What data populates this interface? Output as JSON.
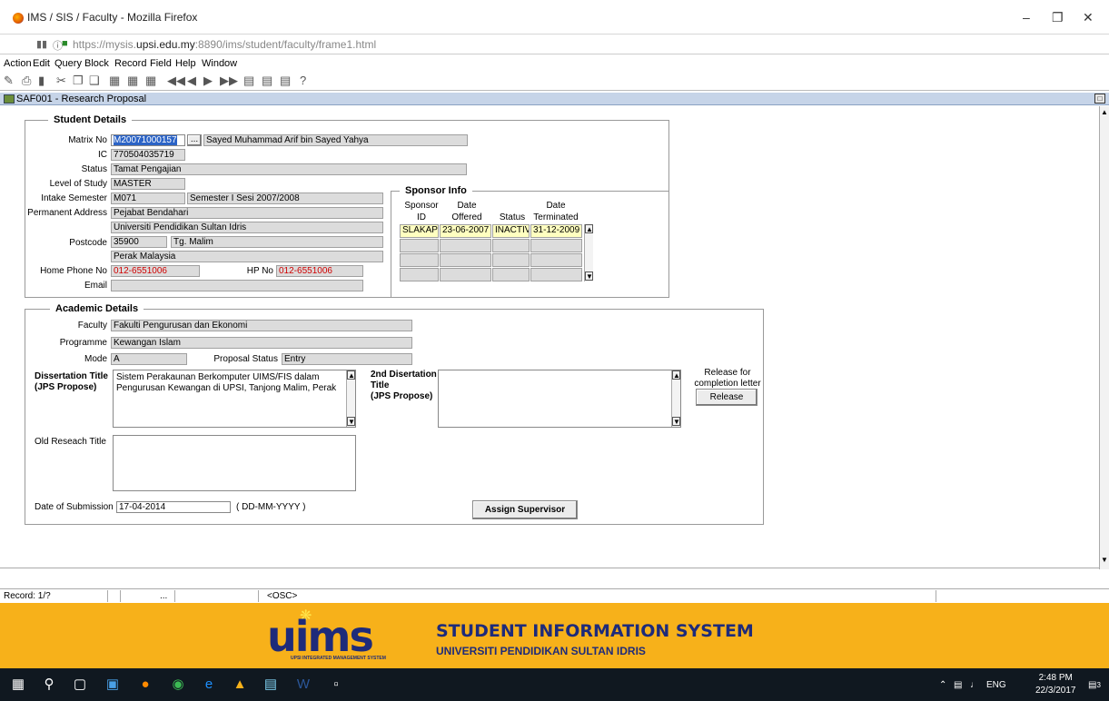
{
  "browser": {
    "window_title": "IMS / SIS / Faculty - Mozilla Firefox",
    "url_prefix": "https://mysis.",
    "url_domain": "upsi.edu.my",
    "url_suffix": ":8890/ims/student/faculty/frame1.html"
  },
  "menu": [
    "Action",
    "Edit",
    "Query",
    "Block",
    "Record",
    "Field",
    "Help",
    "Window"
  ],
  "form_title": "SAF001 - Research Proposal",
  "student": {
    "section_title": "Student Details",
    "matrix_label": "Matrix No",
    "matrix_value": "M20071000157",
    "lov_label": "...",
    "name_value": "Sayed Muhammad Arif bin Sayed Yahya",
    "ic_label": "IC",
    "ic_value": "770504035719",
    "status_label": "Status",
    "status_value": "Tamat Pengajian",
    "level_label": "Level of Study",
    "level_value": "MASTER",
    "intake_label": "Intake Semester",
    "intake_code": "M071",
    "intake_desc": "Semester I Sesi 2007/2008",
    "address_label": "Permanent Address",
    "address_1": "Pejabat Bendahari",
    "address_2": "Universiti Pendidikan Sultan Idris",
    "postcode_label": "Postcode",
    "postcode_value": "35900",
    "city_value": "Tg. Malim",
    "state_value": "Perak Malaysia",
    "home_phone_label": "Home Phone No",
    "home_phone_value": "012-6551006",
    "hp_label": "HP No",
    "hp_value": "012-6551006",
    "email_label": "Email",
    "email_value": ""
  },
  "sponsor": {
    "section_title": "Sponsor Info",
    "headers": {
      "id_line1": "Sponsor",
      "id_line2": "ID",
      "offered_line1": "Date",
      "offered_line2": "Offered",
      "status": "Status",
      "term_line1": "Date",
      "term_line2": "Terminated"
    },
    "rows": [
      {
        "id": "SLAKAP",
        "offered": "23-06-2007",
        "status": "INACTIVE",
        "terminated": "31-12-2009"
      }
    ]
  },
  "academic": {
    "section_title": "Academic Details",
    "faculty_label": "Faculty",
    "faculty_value": "Fakulti Pengurusan dan Ekonomi",
    "programme_label": "Programme",
    "programme_value": "Kewangan Islam",
    "mode_label": "Mode",
    "mode_value": "A",
    "proposal_status_label": "Proposal Status",
    "proposal_status_value": "Entry",
    "dissertation_label_1": "Dissertation Title",
    "dissertation_label_2": "(JPS Propose)",
    "dissertation_value": "Sistem Perakaunan Berkomputer UIMS/FIS dalam Pengurusan Kewangan di UPSI, Tanjong Malim, Perak",
    "second_label_1": "2nd Disertation",
    "second_label_2": "Title",
    "second_label_3": "(JPS Propose)",
    "second_value": "",
    "release_label_1": "Release for",
    "release_label_2": "completion letter",
    "release_button": "Release",
    "old_title_label": "Old Reseach Title",
    "old_title_value": "",
    "submission_label": "Date of Submission",
    "submission_value": "17-04-2014",
    "submission_format": "( DD-MM-YYYY )",
    "assign_button": "Assign Supervisor"
  },
  "statusbar": {
    "record": "Record: 1/?",
    "dots": "...",
    "osc": "<OSC>"
  },
  "banner": {
    "logo_text": "uims",
    "logo_sub": "UPSI INTEGRATED MANAGEMENT SYSTEM",
    "title": "STUDENT INFORMATION SYSTEM",
    "subtitle": "UNIVERSITI PENDIDIKAN SULTAN IDRIS"
  },
  "taskbar": {
    "lang": "ENG",
    "time": "2:48 PM",
    "date": "22/3/2017",
    "notif_count": "3"
  }
}
